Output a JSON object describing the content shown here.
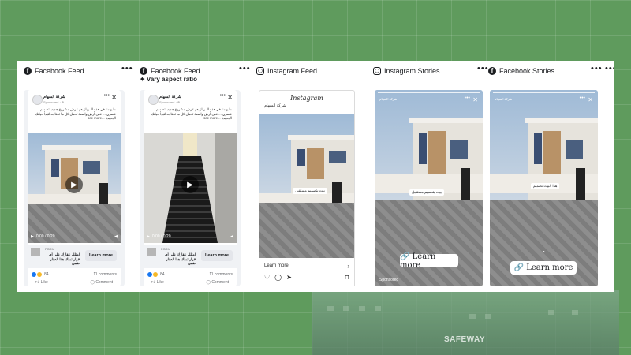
{
  "columns": [
    {
      "icon": "facebook-icon",
      "title": "Facebook Feed",
      "badge": ""
    },
    {
      "icon": "facebook-icon",
      "title": "Facebook Feed",
      "badge": "✦ Vary aspect ratio"
    },
    {
      "icon": "instagram-icon",
      "title": "Instagram Feed",
      "badge": ""
    },
    {
      "icon": "instagram-icon",
      "title": "Instagram Stories",
      "badge": ""
    },
    {
      "icon": "facebook-icon",
      "title": "Facebook Stories",
      "badge": ""
    }
  ],
  "menu_dots": "•••",
  "fb_post": {
    "page_name": "شركة السهام",
    "sponsored": "Sponsored · ⊕",
    "body": "ما يهمنا في هذه الـ ريلز هو عرض مشروع جديد بتصميم عصري ... على أرض واسعة تحمل كل ما تحتاجه لتبدأ حياتك الجديدة ...see more",
    "video_time": "0:00 / 0:20",
    "cta_form": "FORM",
    "cta_title": "امتلك عقارك على أي قرار تملك هذا العقار ضمن",
    "cta_button": "Learn more",
    "reactions_count": "84",
    "comments": "11 comments",
    "like": "Like",
    "comment": "Comment"
  },
  "instagram": {
    "logo": "Instagram",
    "page_name": "شركة السهام",
    "overlay": "بيت بتصميم مستقبل",
    "learn_more": "Learn more",
    "arrow": "›",
    "icons": [
      "♡",
      "◯",
      "➤",
      "⊓"
    ]
  },
  "ig_story": {
    "page_name": "شركة السهام",
    "overlay": "بيت بتصميم مستقبل",
    "cta": "🔗 Learn more",
    "sponsored": "Sponsored"
  },
  "fb_story": {
    "page_name": "شركة السهام",
    "overlay": "هذا البيت تصميم",
    "cta": "🔗 Learn more",
    "swipe": "⌃"
  },
  "background": {
    "sign": "SAFEWAY"
  },
  "colors": {
    "fb_blue": "#1877f2",
    "panel_bg": "#ffffff",
    "bg_green": "#5f9b5d"
  }
}
